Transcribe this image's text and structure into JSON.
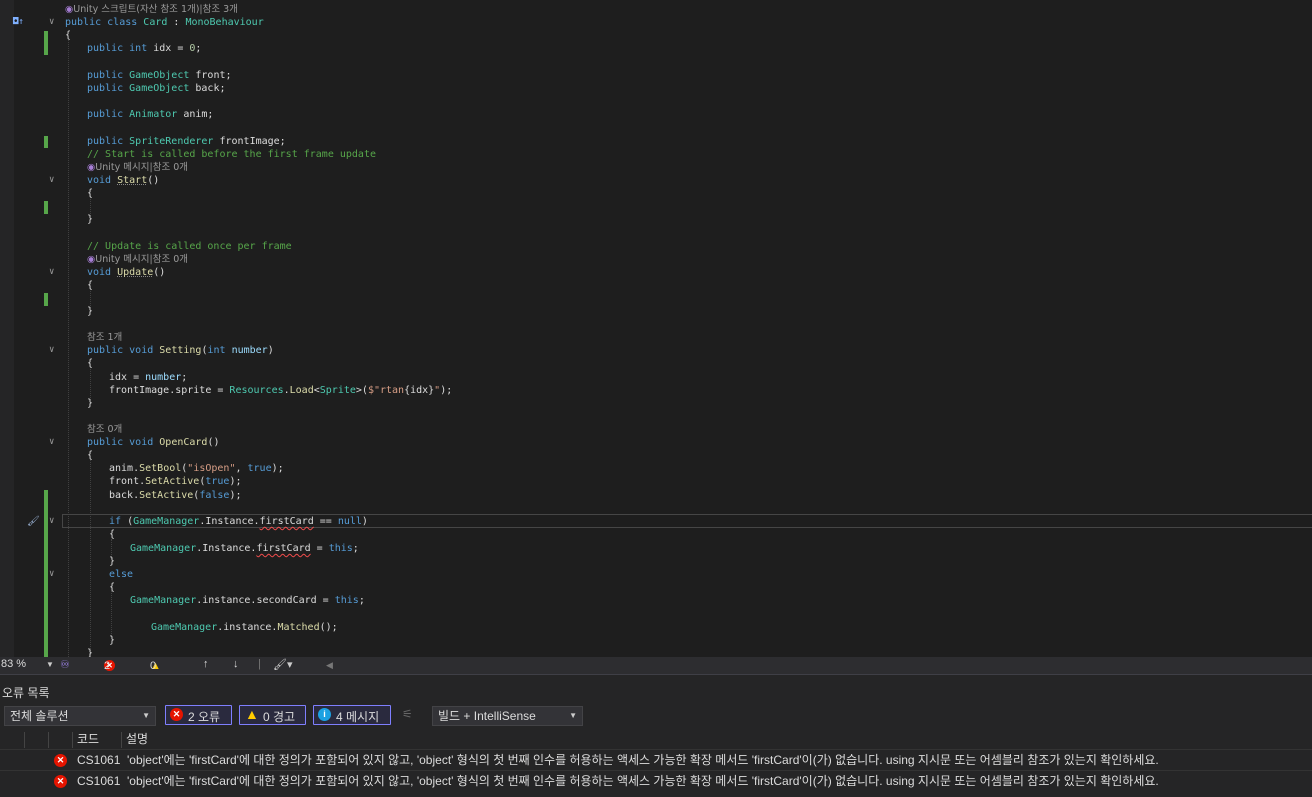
{
  "editor": {
    "class_ref_lens": "Unity 스크립트(자산 참조 1개)|참조 3개",
    "unity_msg_lens": "Unity 메시지|참조 0개",
    "ref1_lens": "참조 1개",
    "ref0_lens": "참조 0개"
  },
  "statusbar": {
    "zoom": "83 %",
    "errors": "2",
    "warnings": "0"
  },
  "panel": {
    "title": "오류 목록",
    "scope": "전체 솔루션",
    "errors_btn": "2 오류",
    "warnings_btn": "0 경고",
    "messages_btn": "4 메시지",
    "build_filter": "빌드 + IntelliSense",
    "col_code": "코드",
    "col_desc": "설명",
    "rows": [
      {
        "code": "CS1061",
        "desc": "'object'에는 'firstCard'에 대한 정의가 포함되어 있지 않고, 'object' 형식의 첫 번째 인수를 허용하는 액세스 가능한 확장 메서드 'firstCard'이(가) 없습니다. using 지시문 또는 어셈블리 참조가 있는지 확인하세요."
      },
      {
        "code": "CS1061",
        "desc": "'object'에는 'firstCard'에 대한 정의가 포함되어 있지 않고, 'object' 형식의 첫 번째 인수를 허용하는 액세스 가능한 확장 메서드 'firstCard'이(가) 없습니다. using 지시문 또는 어셈블리 참조가 있는지 확인하세요."
      }
    ]
  },
  "icons": {
    "error": "error-circle-icon",
    "warning": "warning-triangle-icon",
    "info": "info-circle-icon"
  },
  "colors": {
    "keyword": "#569cd6",
    "type": "#4ec9b0",
    "comment": "#57a64a",
    "string": "#d69d85",
    "change_bar": "#57a64a",
    "error": "#e51400"
  }
}
